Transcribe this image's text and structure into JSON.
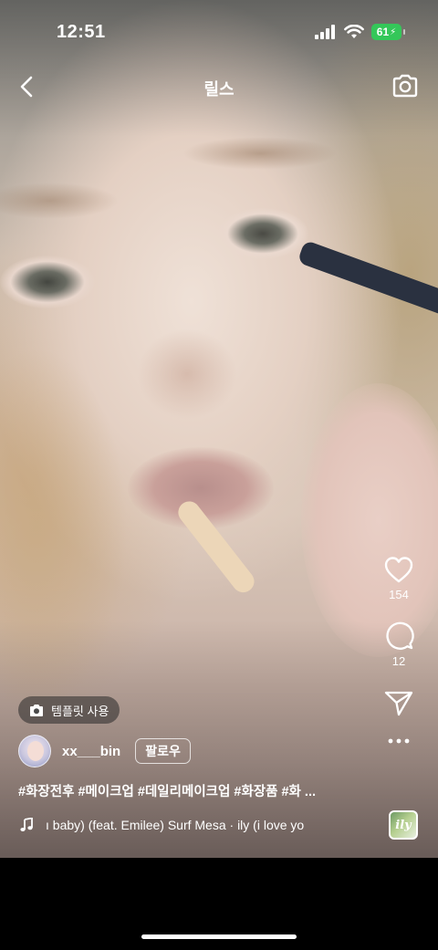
{
  "status_bar": {
    "time": "12:51",
    "battery": "61"
  },
  "header": {
    "title": "릴스"
  },
  "actions": {
    "like_count": "154",
    "comment_count": "12"
  },
  "template_button": {
    "label": "템플릿 사용"
  },
  "user": {
    "username": "xx___bin",
    "follow_label": "팔로우"
  },
  "caption": "#화장전후 #메이크업 #데일리메이크업 #화장품 #화 ...",
  "music": {
    "text": "ı baby) (feat. Emilee)  Surf Mesa · ily (i love yo",
    "thumbnail_text": "ily"
  },
  "colors": {
    "battery_green": "#34c759",
    "background": "#000000"
  }
}
